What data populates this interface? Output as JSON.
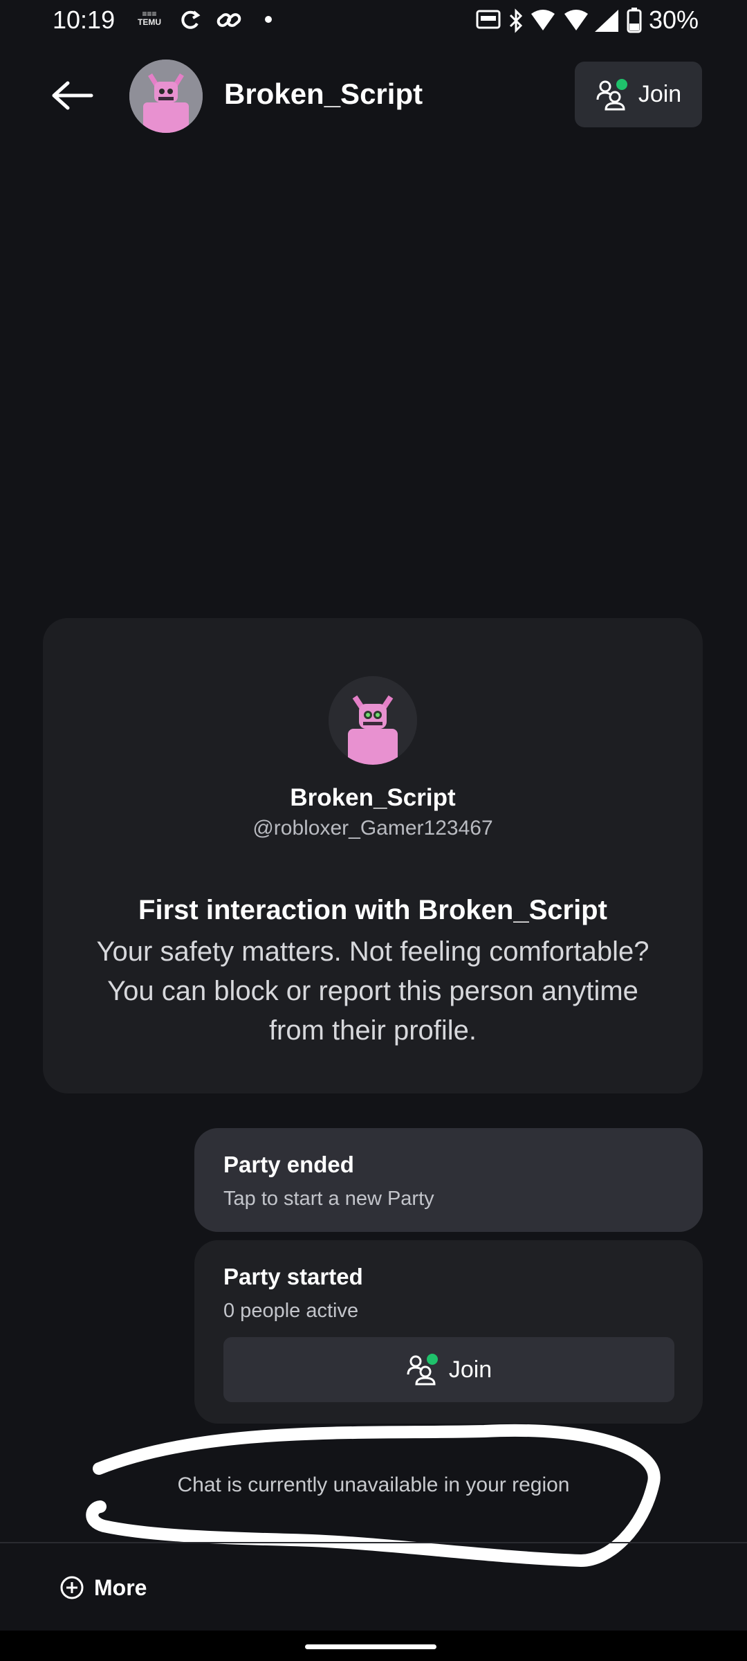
{
  "status_bar": {
    "time": "10:19",
    "temu_top": "≡≡≡",
    "temu_label": "TEMU",
    "battery": "30%",
    "icons": [
      "temu-icon",
      "refresh-icon",
      "link-icon",
      "dot-icon",
      "auto-hz-icon",
      "bluetooth-icon",
      "wifi-icon",
      "wifi-icon",
      "signal-icon",
      "battery-icon"
    ]
  },
  "header": {
    "name": "Broken_Script",
    "join_label": "Join",
    "presence_color": "#1fc16b"
  },
  "card": {
    "name": "Broken_Script",
    "handle": "@robloxer_Gamer123467",
    "title": "First interaction with Broken_Script",
    "body": "Your safety matters. Not feeling comfortable? You can block or report this person anytime from their profile."
  },
  "party_ended": {
    "title": "Party ended",
    "subtitle": "Tap to start a new Party"
  },
  "party_started": {
    "title": "Party started",
    "subtitle": "0 people active",
    "join_label": "Join"
  },
  "notice": "Chat is currently unavailable in your region",
  "bottom": {
    "more_label": "More"
  },
  "colors": {
    "background": "#121317",
    "card": "#1d1e22",
    "bubble": "#2f3037",
    "accent_green": "#1fc16b"
  }
}
